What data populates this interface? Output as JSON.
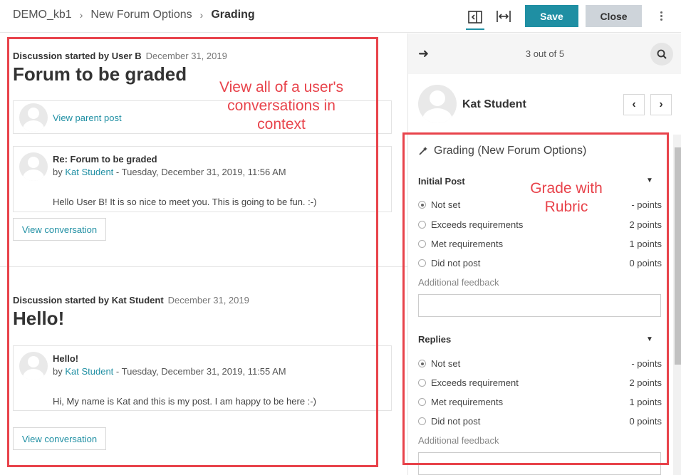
{
  "header": {
    "breadcrumbs": [
      "DEMO_kb1",
      "New Forum Options"
    ],
    "current": "Grading",
    "save_label": "Save",
    "close_label": "Close"
  },
  "discussions": [
    {
      "started_by_label": "Discussion started by User B",
      "date": "December 31, 2019",
      "title": "Forum to be graded",
      "parent_link": "View parent post",
      "post": {
        "subject": "Re: Forum to be graded",
        "by": "by",
        "author": "Kat Student",
        "datetime": " - Tuesday, December 31, 2019, 11:56 AM",
        "message": "Hello User B! It is so nice to meet you. This is going to be fun. :-)"
      },
      "view_conversation": "View conversation"
    },
    {
      "started_by_label": "Discussion started by Kat Student",
      "date": "December 31, 2019",
      "title": "Hello!",
      "post": {
        "subject": "Hello!",
        "by": "by",
        "author": "Kat Student",
        "datetime": " - Tuesday, December 31, 2019, 11:55 AM",
        "message": "Hi, My name is Kat and this is my post.  I am happy to be here :-)"
      },
      "view_conversation": "View conversation"
    }
  ],
  "grader": {
    "count": "3 out of 5",
    "user_name": "Kat Student",
    "heading": "Grading (New Forum Options)",
    "criteria": [
      {
        "title": "Initial Post",
        "levels": [
          {
            "label": "Not set",
            "points": "- points",
            "selected": true
          },
          {
            "label": "Exceeds requirements",
            "points": "2 points"
          },
          {
            "label": "Met requirements",
            "points": "1 points"
          },
          {
            "label": "Did not post",
            "points": "0 points"
          }
        ],
        "feedback_label": "Additional feedback"
      },
      {
        "title": "Replies",
        "levels": [
          {
            "label": "Not set",
            "points": "- points",
            "selected": true
          },
          {
            "label": "Exceeds requirement",
            "points": "2 points"
          },
          {
            "label": "Met requirements",
            "points": "1 points"
          },
          {
            "label": "Did not post",
            "points": "0 points"
          }
        ],
        "feedback_label": "Additional feedback"
      }
    ]
  },
  "annotations": {
    "left": "View all of a user's conversations in context",
    "right": "Grade with Rubric"
  },
  "colors": {
    "accent": "#1f8fa3",
    "annotation": "#e8434b"
  }
}
